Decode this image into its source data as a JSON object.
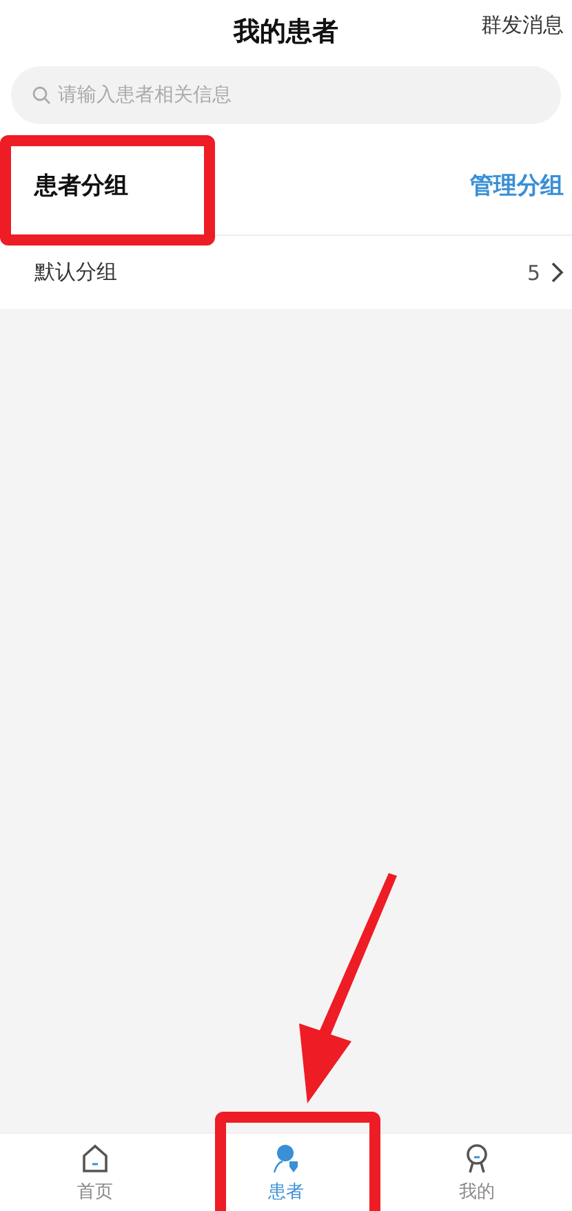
{
  "header": {
    "title": "我的患者",
    "action": "群发消息"
  },
  "search": {
    "placeholder": "请输入患者相关信息"
  },
  "section": {
    "title": "患者分组",
    "action": "管理分组"
  },
  "groups": [
    {
      "name": "默认分组",
      "count": "5"
    }
  ],
  "tabs": [
    {
      "label": "首页",
      "kind": "home",
      "selected": false
    },
    {
      "label": "患者",
      "kind": "patient",
      "selected": true
    },
    {
      "label": "我的",
      "kind": "profile",
      "selected": false
    }
  ]
}
